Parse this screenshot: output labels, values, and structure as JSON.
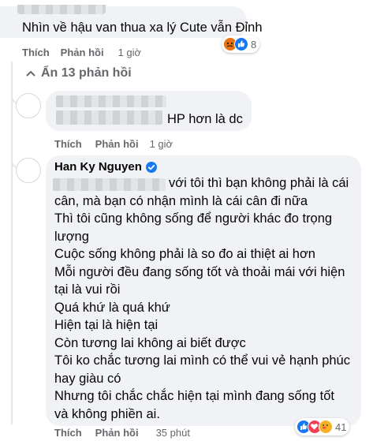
{
  "comment1": {
    "text": "Nhìn về hậu van thua xa lý Cute vẫn Đỉnh",
    "reaction_count": "8",
    "actions": {
      "like": "Thích",
      "reply": "Phản hồi",
      "time": "1 giờ"
    }
  },
  "hidden_replies_label": "Ẩn 13 phản hồi",
  "reply1": {
    "text": "HP hơn là dc",
    "actions": {
      "like": "Thích",
      "reply": "Phản hồi",
      "time": "1 giờ"
    }
  },
  "reply2": {
    "author": "Han Ky Nguyen",
    "lines": [
      "với tôi thì bạn không phải là cái",
      "cân, mà bạn có nhận mình là cái cân đi nữa",
      "Thì tôi cũng không sống để người khác đo trọng",
      "lượng",
      "Cuộc sống không phải là so đo ai thiệt ai hơn",
      "Mỗi người đều đang sống tốt và thoải mái với hiện",
      "tại là vui rồi",
      "Quá khứ là quá khứ",
      "Hiện tại là hiện tại",
      "Còn tương lai không ai biết được",
      "Tôi ko chắc tương lai mình có thể vui vẻ hạnh phúc",
      "hay giàu có",
      "Nhưng tôi chắc chắc hiện tại mình đang sống tốt",
      "và không phiền ai."
    ],
    "reaction_count": "41",
    "actions": {
      "like": "Thích",
      "reply": "Phản hồi",
      "time": "35 phút"
    }
  },
  "colors": {
    "bubble": "#f0f2f5",
    "meta_text": "#65676b",
    "verified": "#1877f2",
    "like": "#1877f2",
    "love": "#f33e58",
    "angry": "#e9710f",
    "care": "#f7b125"
  }
}
